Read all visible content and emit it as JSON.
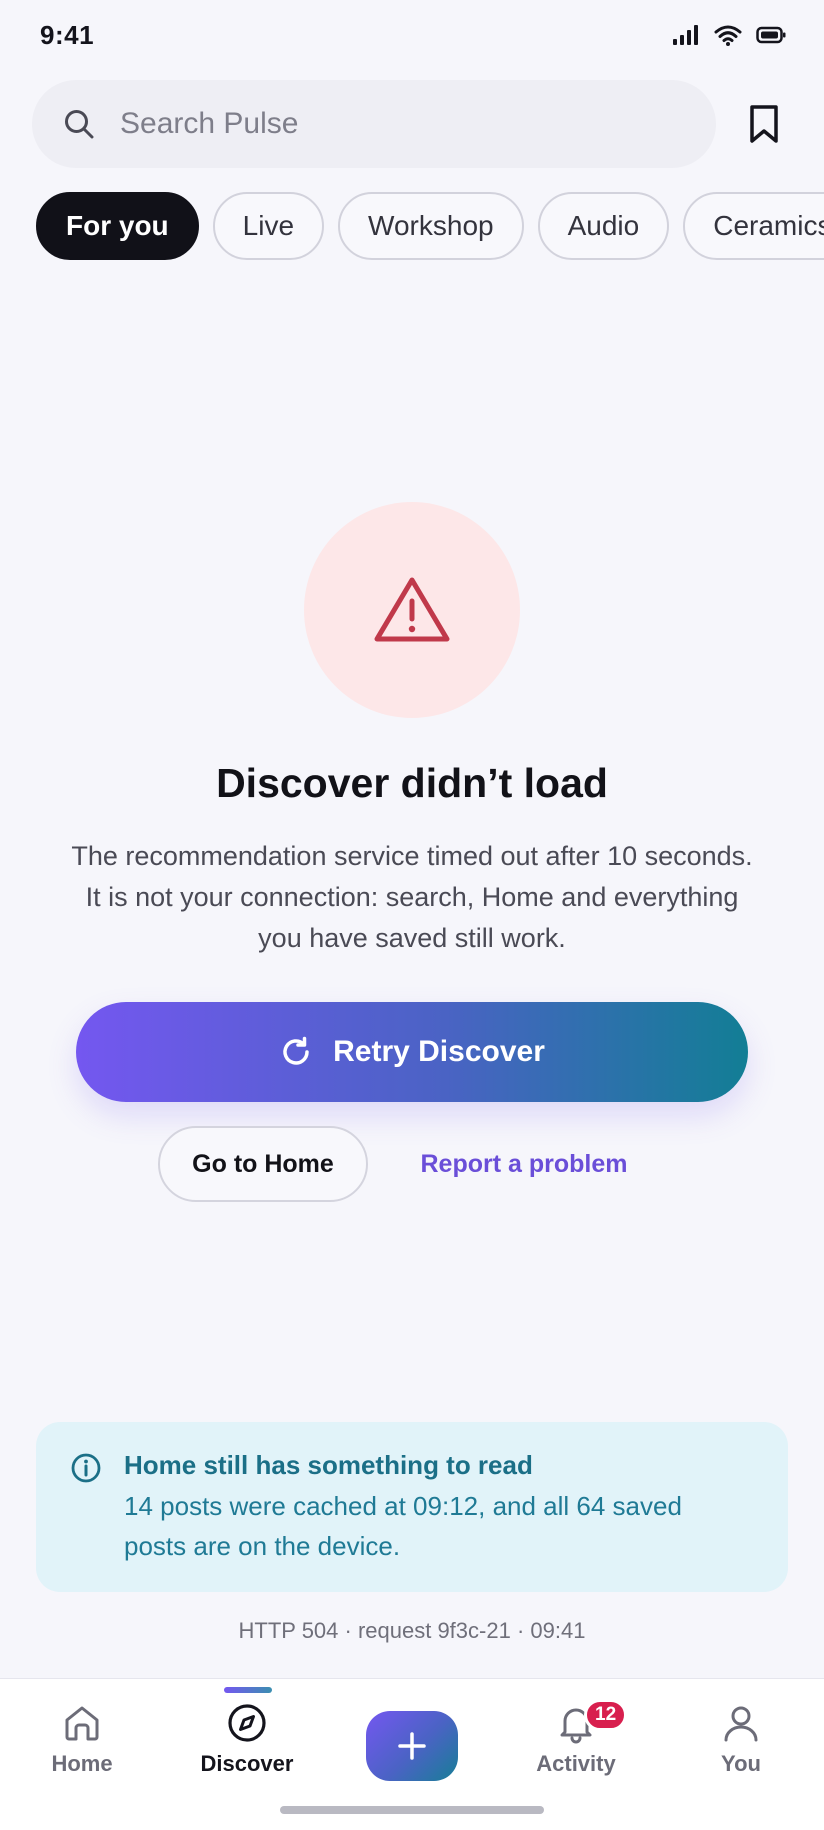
{
  "status_bar": {
    "time": "9:41"
  },
  "search": {
    "placeholder": "Search Pulse",
    "value": ""
  },
  "chips": [
    "For you",
    "Live",
    "Workshop",
    "Audio",
    "Ceramics"
  ],
  "chips_active_index": 0,
  "error": {
    "title": "Discover didn’t load",
    "description": "The recommendation service timed out after 10 seconds. It is not your connection: search, Home and everything you have saved still work.",
    "retry_label": "Retry Discover",
    "home_label": "Go to Home",
    "report_label": "Report a problem"
  },
  "info_card": {
    "title": "Home still has something to read",
    "body": "14 posts were cached at 09:12, and all 64 saved posts are on the device."
  },
  "debug_line": "HTTP 504 · request 9f3c-21 · 09:41",
  "tab_bar": {
    "tabs": [
      {
        "label": "Home",
        "icon": "home-icon"
      },
      {
        "label": "Discover",
        "icon": "compass-icon"
      },
      {
        "label": "Activity",
        "icon": "bell-icon"
      },
      {
        "label": "You",
        "icon": "user-icon"
      }
    ],
    "active": "Discover",
    "activity_badge": "12"
  },
  "colors": {
    "accent_purple": "#7457f0",
    "accent_teal": "#127e95",
    "error_red": "#c0394a",
    "info_teal": "#1b6f87",
    "badge_red": "#d81f4e"
  }
}
